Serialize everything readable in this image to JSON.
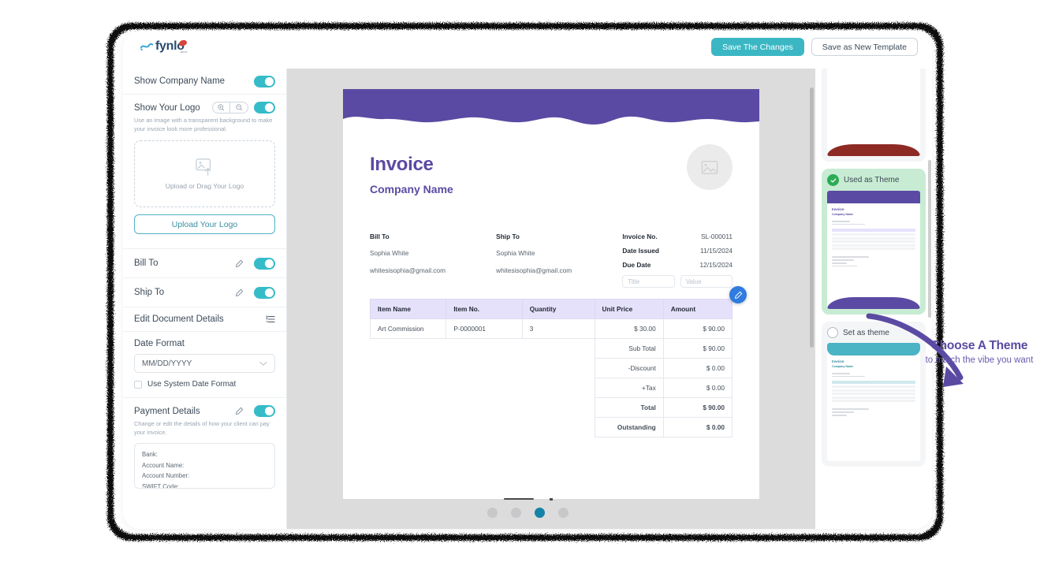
{
  "app": {
    "logo_text": "fynlo",
    "logo_sub": "BETA"
  },
  "toolbar": {
    "save_changes_label": "Save The Changes",
    "save_template_label": "Save as New Template"
  },
  "sidebar": {
    "rows": [
      {
        "label": "Show Company Name",
        "toggle": "on"
      },
      {
        "label": "Show Your Logo",
        "hint": "Use an image with a transparent background to make your invoice look more professional.",
        "toggle": "on",
        "dropzone_text": "Upload or Drag Your Logo",
        "upload_button": "Upload Your Logo"
      },
      {
        "label": "Bill To",
        "toggle": "on"
      },
      {
        "label": "Ship To",
        "toggle": "on"
      },
      {
        "label": "Edit Document Details"
      },
      {
        "label": "Date Format",
        "select_value": "MM/DD/YYYY",
        "checkbox_label": "Use System Date Format"
      },
      {
        "label": "Payment Details",
        "toggle": "on",
        "hint": "Change or edit the details of how your client can pay your invoice.",
        "fields": "Bank:\nAccount Name:\nAccount Number:\nSWIFT Code:\nBSB:"
      }
    ]
  },
  "invoice": {
    "title": "Invoice",
    "company": "Company Name",
    "bill_to_label": "Bill To",
    "bill_to_name": "Sophia White",
    "bill_to_email": "whitesisophia@gmail.com",
    "ship_to_label": "Ship To",
    "ship_to_name": "Sophia White",
    "ship_to_email": "whitesisophia@gmail.com",
    "meta": [
      {
        "key": "Invoice No.",
        "value": "SL-000011"
      },
      {
        "key": "Date Issued",
        "value": "11/15/2024"
      },
      {
        "key": "Due Date",
        "value": "12/15/2024"
      }
    ],
    "custom_field": {
      "title_placeholder": "Title",
      "value_placeholder": "Value"
    },
    "table": {
      "headers": [
        "Item Name",
        "Item No.",
        "Quantity",
        "Unit Price",
        "Amount"
      ],
      "rows": [
        {
          "name": "Art Commission",
          "no": "P-0000001",
          "qty": "3",
          "price": "$ 30.00",
          "amount": "$ 90.00"
        }
      ],
      "totals": [
        {
          "label": "Sub Total",
          "value": "$ 90.00",
          "bold": false
        },
        {
          "label": "-Discount",
          "value": "$ 0.00",
          "bold": false
        },
        {
          "label": "+Tax",
          "value": "$ 0.00",
          "bold": false
        },
        {
          "label": "Total",
          "value": "$ 90.00",
          "bold": true
        },
        {
          "label": "Outstanding",
          "value": "$ 0.00",
          "bold": true
        }
      ]
    }
  },
  "themes": {
    "cards": [
      {
        "id": "red",
        "status": "",
        "accent": "#8e2a24"
      },
      {
        "id": "purple",
        "status": "Used as Theme",
        "accent": "#5b4aa3"
      },
      {
        "id": "teal",
        "status": "Set as theme",
        "accent": "#4ab3c4"
      }
    ]
  },
  "pagination": {
    "count": 4,
    "active_index": 2
  },
  "annotation": {
    "headline": "Choose A Theme",
    "subline": "to match the vibe you want",
    "color": "#5b4aa3"
  },
  "colors": {
    "teal": "#3bb7c4",
    "purple": "#5b4aa3",
    "table_header": "#e6e1fb",
    "dot_active": "#1483a8",
    "fab_blue": "#2f7be0"
  }
}
